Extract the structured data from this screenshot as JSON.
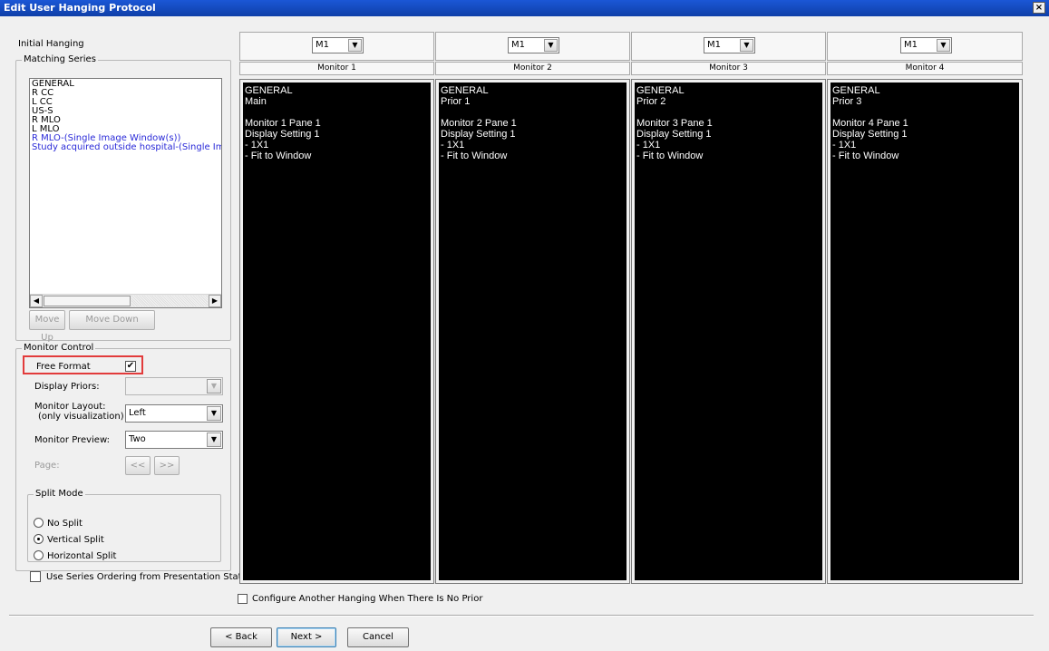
{
  "window": {
    "title": "Edit User Hanging Protocol",
    "close_glyph": "×"
  },
  "left": {
    "initial_hanging_label": "Initial Hanging",
    "matching_series_label": "Matching Series",
    "series": [
      {
        "label": "GENERAL",
        "blue": false
      },
      {
        "label": "R CC",
        "blue": false
      },
      {
        "label": "L CC",
        "blue": false
      },
      {
        "label": "US-S",
        "blue": false
      },
      {
        "label": "R MLO",
        "blue": false
      },
      {
        "label": "L MLO",
        "blue": false
      },
      {
        "label": "R MLO-(Single Image Window(s))",
        "blue": true
      },
      {
        "label": "Study acquired outside hospital-(Single Image W",
        "blue": true
      }
    ],
    "move_up": "Move Up",
    "move_down": "Move Down"
  },
  "monitor_control": {
    "legend": "Monitor Control",
    "free_format_label": "Free Format",
    "free_format_checked": "✔",
    "display_priors_label": "Display Priors:",
    "display_priors_value": "",
    "layout_label_1": "Monitor Layout:",
    "layout_label_2": "(only visualization)",
    "layout_value": "Left",
    "preview_label": "Monitor Preview:",
    "preview_value": "Two",
    "page_label": "Page:",
    "page_prev": "<<",
    "page_next": ">>",
    "split_legend": "Split Mode",
    "split_options": [
      "No Split",
      "Vertical Split",
      "Horizontal Split"
    ],
    "split_selected": "Vertical Split"
  },
  "use_series_ordering": "Use Series Ordering from Presentation State",
  "monitors": [
    {
      "select": "M1",
      "name": "Monitor 1",
      "lines": [
        "GENERAL",
        "Main",
        "",
        "Monitor 1 Pane 1",
        "Display Setting 1",
        "- 1X1",
        "- Fit to Window"
      ]
    },
    {
      "select": "M1",
      "name": "Monitor 2",
      "lines": [
        "GENERAL",
        "Prior 1",
        "",
        "Monitor 2 Pane 1",
        "Display Setting 1",
        "- 1X1",
        "- Fit to Window"
      ]
    },
    {
      "select": "M1",
      "name": "Monitor 3",
      "lines": [
        "GENERAL",
        "Prior 2",
        "",
        "Monitor 3 Pane 1",
        "Display Setting 1",
        "- 1X1",
        "- Fit to Window"
      ]
    },
    {
      "select": "M1",
      "name": "Monitor 4",
      "lines": [
        "GENERAL",
        "Prior 3",
        "",
        "Monitor 4 Pane 1",
        "Display Setting 1",
        "- 1X1",
        "- Fit to Window"
      ]
    }
  ],
  "configure_another": "Configure Another Hanging When There Is No Prior",
  "buttons": {
    "back": "< Back",
    "next": "Next >",
    "cancel": "Cancel"
  },
  "icons": {
    "dropdown": "chevron-down-icon",
    "scroll_left": "arrow-left-icon",
    "scroll_right": "arrow-right-icon",
    "close": "close-icon",
    "check": "check-icon"
  },
  "colors": {
    "titlebar": "#1b57d6",
    "blue_item": "#2a2ad8",
    "highlight": "#e23b3b",
    "pane_bg": "#000000"
  }
}
